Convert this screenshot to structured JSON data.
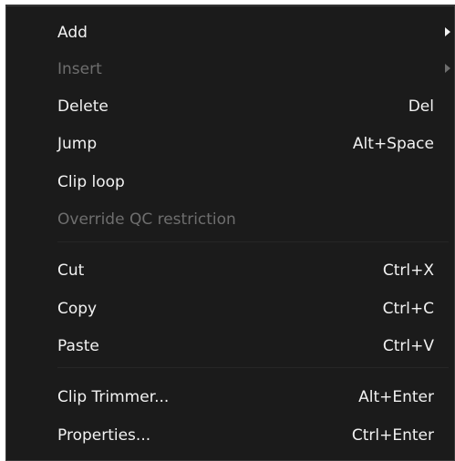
{
  "menu": {
    "add": {
      "label": "Add",
      "icon": "submenu-arrow-icon"
    },
    "insert": {
      "label": "Insert",
      "icon": "submenu-arrow-icon"
    },
    "delete": {
      "label": "Delete",
      "shortcut": "Del"
    },
    "jump": {
      "label": "Jump",
      "shortcut": "Alt+Space"
    },
    "clip_loop": {
      "label": "Clip loop"
    },
    "override_qc": {
      "label": "Override QC restriction"
    },
    "cut": {
      "label": "Cut",
      "shortcut": "Ctrl+X"
    },
    "copy": {
      "label": "Copy",
      "shortcut": "Ctrl+C"
    },
    "paste": {
      "label": "Paste",
      "shortcut": "Ctrl+V"
    },
    "clip_trimmer": {
      "label": "Clip Trimmer...",
      "shortcut": "Alt+Enter"
    },
    "properties": {
      "label": "Properties...",
      "shortcut": "Ctrl+Enter"
    }
  },
  "colors": {
    "background": "#1b1b1b",
    "text": "#f2f2f2",
    "disabled_text": "#6e6e6e"
  }
}
